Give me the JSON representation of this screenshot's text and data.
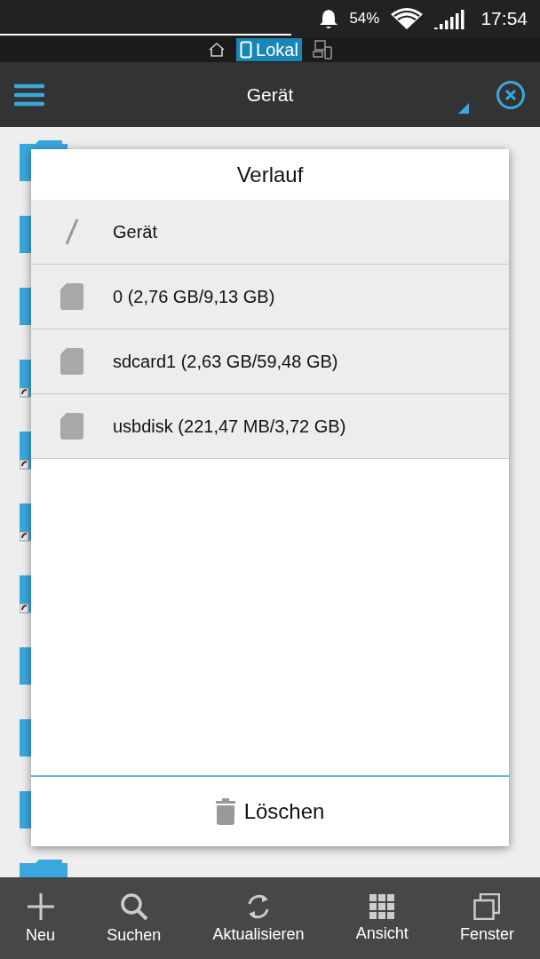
{
  "status_bar": {
    "battery": "54%",
    "time": "17:54"
  },
  "tabs": [
    {
      "kind": "home",
      "selected": false
    },
    {
      "kind": "local",
      "label": "Lokal",
      "selected": true
    },
    {
      "kind": "remote",
      "selected": false
    }
  ],
  "action_bar": {
    "title": "Gerät"
  },
  "folders": [
    {
      "shortcut": false
    },
    {
      "shortcut": false
    },
    {
      "shortcut": false
    },
    {
      "shortcut": true
    },
    {
      "shortcut": true
    },
    {
      "shortcut": true
    },
    {
      "shortcut": true
    },
    {
      "shortcut": false
    },
    {
      "shortcut": false
    },
    {
      "shortcut": false
    }
  ],
  "dialog": {
    "title": "Verlauf",
    "items": [
      {
        "kind": "root",
        "label": "Gerät"
      },
      {
        "kind": "sd",
        "label": "0 (2,76 GB/9,13 GB)"
      },
      {
        "kind": "sd",
        "label": "sdcard1 (2,63 GB/59,48 GB)"
      },
      {
        "kind": "sd",
        "label": "usbdisk (221,47 MB/3,72 GB)"
      }
    ],
    "clear_button": "Löschen"
  },
  "toolbar": [
    {
      "kind": "new",
      "label": "Neu"
    },
    {
      "kind": "search",
      "label": "Suchen"
    },
    {
      "kind": "refresh",
      "label": "Aktualisieren"
    },
    {
      "kind": "view",
      "label": "Ansicht"
    },
    {
      "kind": "window",
      "label": "Fenster"
    }
  ]
}
